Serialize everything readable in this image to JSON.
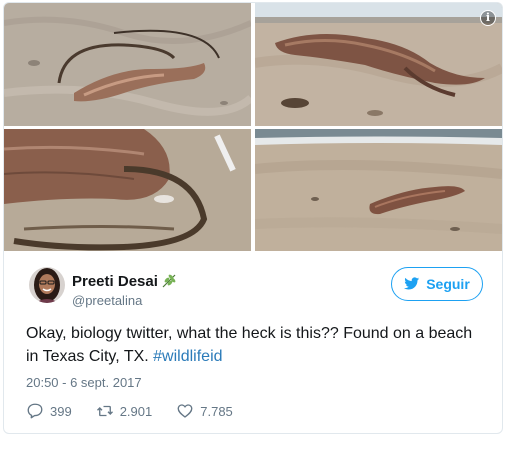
{
  "media": {
    "icons": {
      "info": "info-icon"
    },
    "info_glyph": "i"
  },
  "author": {
    "display_name": "Preeti Desai",
    "handle": "@preetalina",
    "badge_icon": "leaf-icon"
  },
  "follow_button": {
    "label": "Seguir",
    "icon": "twitter-bird-icon"
  },
  "tweet": {
    "text_before": "Okay, biology twitter, what the heck is this?? Found on a beach in Texas City, TX. ",
    "hashtag": "#wildlifeid",
    "timestamp": "20:50 - 6 sept. 2017"
  },
  "actions": {
    "replies": "399",
    "retweets": "2.901",
    "likes": "7.785"
  },
  "colors": {
    "accent": "#1da1f2",
    "hashtag": "#2b7bb9",
    "meta": "#657786",
    "border": "#e1e8ed"
  }
}
